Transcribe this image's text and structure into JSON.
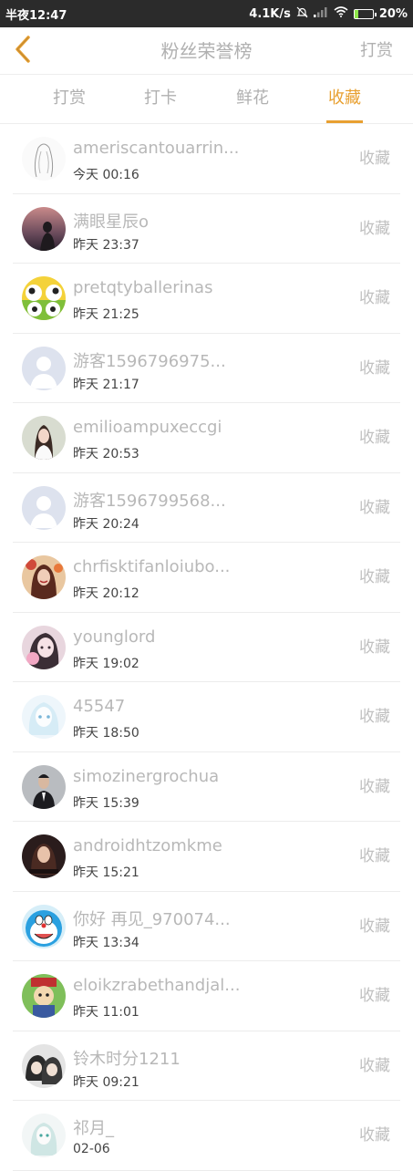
{
  "status_bar": {
    "time": "半夜12:47",
    "network_speed": "4.1K/s",
    "battery": "20%",
    "battery_level": 0.2,
    "icons": [
      "alarm-off-icon",
      "signal-icon",
      "wifi-icon",
      "battery-charging-icon"
    ]
  },
  "header": {
    "title": "粉丝荣誉榜",
    "action": "打赏",
    "back_icon": "chevron-left-icon",
    "accent_color": "#e8a031"
  },
  "tabs": [
    {
      "label": "打赏",
      "active": false
    },
    {
      "label": "打卡",
      "active": false
    },
    {
      "label": "鲜花",
      "active": false
    },
    {
      "label": "收藏",
      "active": true
    }
  ],
  "list": [
    {
      "name": "ameriscantouarrin...",
      "time": "今天 00:16",
      "action": "收藏"
    },
    {
      "name": "满眼星辰o",
      "time": "昨天 23:37",
      "action": "收藏"
    },
    {
      "name": "pretqtyballerinas",
      "time": "昨天 21:25",
      "action": "收藏"
    },
    {
      "name": "游客1596796975...",
      "time": "昨天 21:17",
      "action": "收藏"
    },
    {
      "name": "emilioampuxeccgi",
      "time": "昨天 20:53",
      "action": "收藏"
    },
    {
      "name": "游客1596799568...",
      "time": "昨天 20:24",
      "action": "收藏"
    },
    {
      "name": "chrfisktifanloiubo...",
      "time": "昨天 20:12",
      "action": "收藏"
    },
    {
      "name": "younglord",
      "time": "昨天 19:02",
      "action": "收藏"
    },
    {
      "name": "45547",
      "time": "昨天 18:50",
      "action": "收藏"
    },
    {
      "name": "simozinergrochua",
      "time": "昨天 15:39",
      "action": "收藏"
    },
    {
      "name": "androidhtzomkme",
      "time": "昨天 15:21",
      "action": "收藏"
    },
    {
      "name": "你好 再见_970074...",
      "time": "昨天 13:34",
      "action": "收藏"
    },
    {
      "name": "eloikzrabethandjal...",
      "time": "昨天 11:01",
      "action": "收藏"
    },
    {
      "name": "铃木时分1211",
      "time": "昨天 09:21",
      "action": "收藏"
    },
    {
      "name": "祁月_",
      "time": "02-06",
      "action": "收藏"
    }
  ]
}
